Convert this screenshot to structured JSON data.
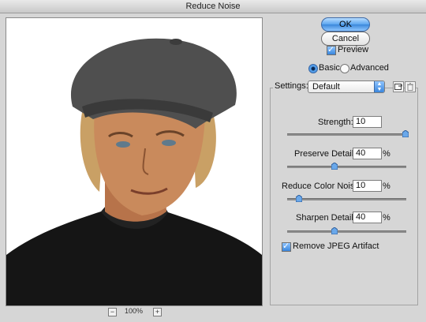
{
  "window": {
    "title": "Reduce Noise"
  },
  "buttons": {
    "ok": "OK",
    "cancel": "Cancel"
  },
  "preview_checkbox": {
    "label": "Preview",
    "checked": true
  },
  "mode": {
    "basic": "Basic",
    "advanced": "Advanced",
    "selected": "Basic"
  },
  "settings": {
    "label": "Settings:",
    "value": "Default"
  },
  "controls": [
    {
      "label": "Strength:",
      "value": "10",
      "unit": "",
      "level": 1.0
    },
    {
      "label": "Preserve Details:",
      "value": "40",
      "unit": "%",
      "level": 0.4
    },
    {
      "label": "Reduce Color Noise:",
      "value": "10",
      "unit": "%",
      "level": 0.1
    },
    {
      "label": "Sharpen Details:",
      "value": "40",
      "unit": "%",
      "level": 0.4
    }
  ],
  "jpeg_checkbox": {
    "label": "Remove JPEG Artifact",
    "checked": true
  },
  "zoom": {
    "minus": "−",
    "level": "100%",
    "plus": "+"
  },
  "icons": {
    "save_settings": "save-settings-icon",
    "delete_settings": "trash-icon"
  },
  "colors": {
    "accent": "#3a86dc",
    "background": "#d6d6d6"
  }
}
